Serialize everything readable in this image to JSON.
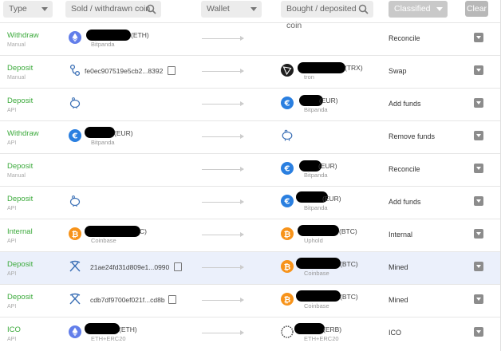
{
  "filters": {
    "type": "Type",
    "sold": "Sold / withdrawn coin",
    "wallet": "Wallet",
    "bought": "Bought / deposited coin",
    "classified": "Classified",
    "clear": "Clear"
  },
  "rows": [
    {
      "type": "Withdraw",
      "sub": "Manual",
      "c1": "(ETH)",
      "c1sub": "Bitpanda",
      "hash": "",
      "c2": "",
      "c2sub": "",
      "label": "Reconcile"
    },
    {
      "type": "Deposit",
      "sub": "Manual",
      "c1": "",
      "c1sub": "",
      "hash": "fe0ec907519e5cb2...8392",
      "c2": "(TRX)",
      "c2sub": "tron",
      "label": "Swap"
    },
    {
      "type": "Deposit",
      "sub": "API",
      "c1": "",
      "c1sub": "",
      "hash": "",
      "c2": "(EUR)",
      "c2sub": "Bitpanda",
      "label": "Add funds"
    },
    {
      "type": "Withdraw",
      "sub": "API",
      "c1": "(EUR)",
      "c1sub": "Bitpanda",
      "hash": "",
      "c2": "",
      "c2sub": "",
      "label": "Remove funds"
    },
    {
      "type": "Deposit",
      "sub": "Manual",
      "c1": "",
      "c1sub": "",
      "hash": "",
      "c2": "(EUR)",
      "c2sub": "Bitpanda",
      "label": "Reconcile"
    },
    {
      "type": "Deposit",
      "sub": "API",
      "c1": "",
      "c1sub": "",
      "hash": "",
      "c2": "(EUR)",
      "c2sub": "Bitpanda",
      "label": "Add funds"
    },
    {
      "type": "Internal",
      "sub": "API",
      "c1": "C)",
      "c1sub": "Coinbase",
      "hash": "",
      "c2": "(BTC)",
      "c2sub": "Uphold",
      "label": "Internal"
    },
    {
      "type": "Deposit",
      "sub": "API",
      "c1": "",
      "c1sub": "",
      "hash": "21ae24fd31d809e1...0990",
      "c2": "(BTC)",
      "c2sub": "Coinbase",
      "label": "Mined"
    },
    {
      "type": "Deposit",
      "sub": "API",
      "c1": "",
      "c1sub": "",
      "hash": "cdb7df9700ef021f...cd8b",
      "c2": "(BTC)",
      "c2sub": "Coinbase",
      "label": "Mined"
    },
    {
      "type": "ICO",
      "sub": "API",
      "c1": "(ETH)",
      "c1sub": "ETH+ERC20",
      "hash": "",
      "c2": "(ERB)",
      "c2sub": "ETH+ERC20",
      "label": "ICO"
    }
  ],
  "colors": {
    "type_green": "#3caa3c",
    "eth": "#627eea",
    "eur": "#2a7fe0",
    "btc": "#f7931a",
    "highlight": "#ebf0fb"
  }
}
